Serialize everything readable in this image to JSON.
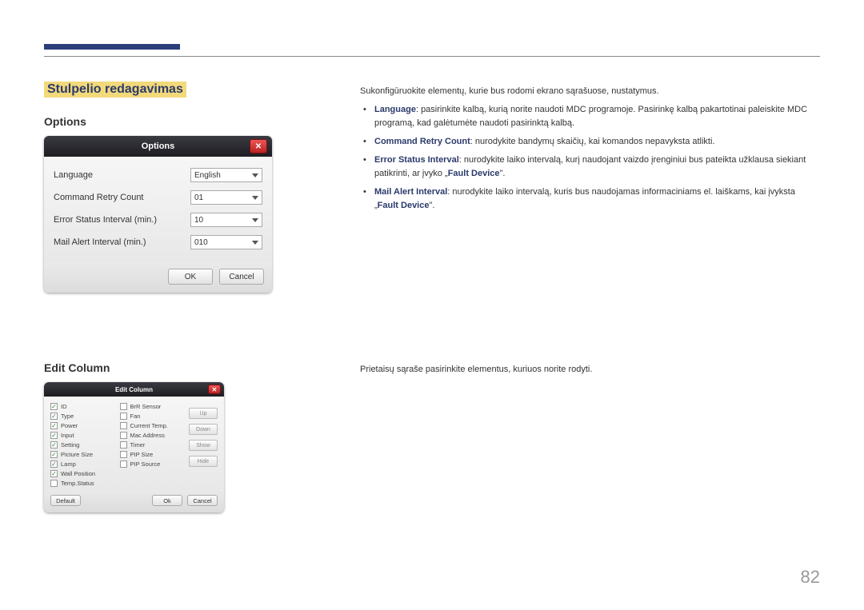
{
  "page_number": "82",
  "section_title": "Stulpelio redagavimas",
  "subheading_options": "Options",
  "subheading_editcolumn": "Edit Column",
  "intro_text": "Sukonfigūruokite elementų, kurie bus rodomi ekrano sąrašuose, nustatymus.",
  "bullets": {
    "language": {
      "kw": "Language",
      "text": ": pasirinkite kalbą, kurią norite naudoti MDC programoje. Pasirinkę kalbą pakartotinai paleiskite MDC programą, kad galėtumėte naudoti pasirinktą kalbą."
    },
    "retry": {
      "kw": "Command Retry Count",
      "text": ": nurodykite bandymų skaičių, kai komandos nepavyksta atlikti."
    },
    "error_interval": {
      "kw": "Error Status Interval",
      "text1": ": nurodykite laiko intervalą, kurį naudojant vaizdo įrenginiui bus pateikta užklausa siekiant patikrinti, ar įvyko „",
      "fault": "Fault Device",
      "text2": "\"."
    },
    "mail_interval": {
      "kw": "Mail Alert Interval",
      "text1": ": nurodykite laiko intervalą, kuris bus naudojamas informaciniams el. laiškams, kai įvyksta „",
      "fault": "Fault Device",
      "text2": "\"."
    }
  },
  "editcolumn_desc": "Prietaisų sąraše pasirinkite elementus, kuriuos norite rodyti.",
  "options_dialog": {
    "title": "Options",
    "rows": {
      "language": {
        "label": "Language",
        "value": "English"
      },
      "retry": {
        "label": "Command Retry Count",
        "value": "01"
      },
      "error": {
        "label": "Error Status Interval (min.)",
        "value": "10"
      },
      "mail": {
        "label": "Mail Alert Interval (min.)",
        "value": "010"
      }
    },
    "ok": "OK",
    "cancel": "Cancel"
  },
  "editcol_dialog": {
    "title": "Edit Column",
    "col1": [
      {
        "checked": true,
        "label": "ID"
      },
      {
        "checked": true,
        "label": "Type"
      },
      {
        "checked": true,
        "label": "Power"
      },
      {
        "checked": true,
        "label": "Input"
      },
      {
        "checked": true,
        "label": "Setting"
      },
      {
        "checked": true,
        "label": "Picture Size"
      },
      {
        "checked": true,
        "label": "Lamp"
      },
      {
        "checked": true,
        "label": "Wall Position"
      },
      {
        "checked": false,
        "label": "Temp.Status"
      }
    ],
    "col2": [
      {
        "checked": false,
        "label": "BrR Sensor"
      },
      {
        "checked": false,
        "label": "Fan"
      },
      {
        "checked": false,
        "label": "Current Temp."
      },
      {
        "checked": false,
        "label": "Mac Address"
      },
      {
        "checked": false,
        "label": "Timer"
      },
      {
        "checked": false,
        "label": "PIP Size"
      },
      {
        "checked": false,
        "label": "PIP Source"
      }
    ],
    "side": {
      "up": "Up",
      "down": "Down",
      "show": "Show",
      "hide": "Hide"
    },
    "default": "Default",
    "ok": "Ok",
    "cancel": "Cancel"
  }
}
